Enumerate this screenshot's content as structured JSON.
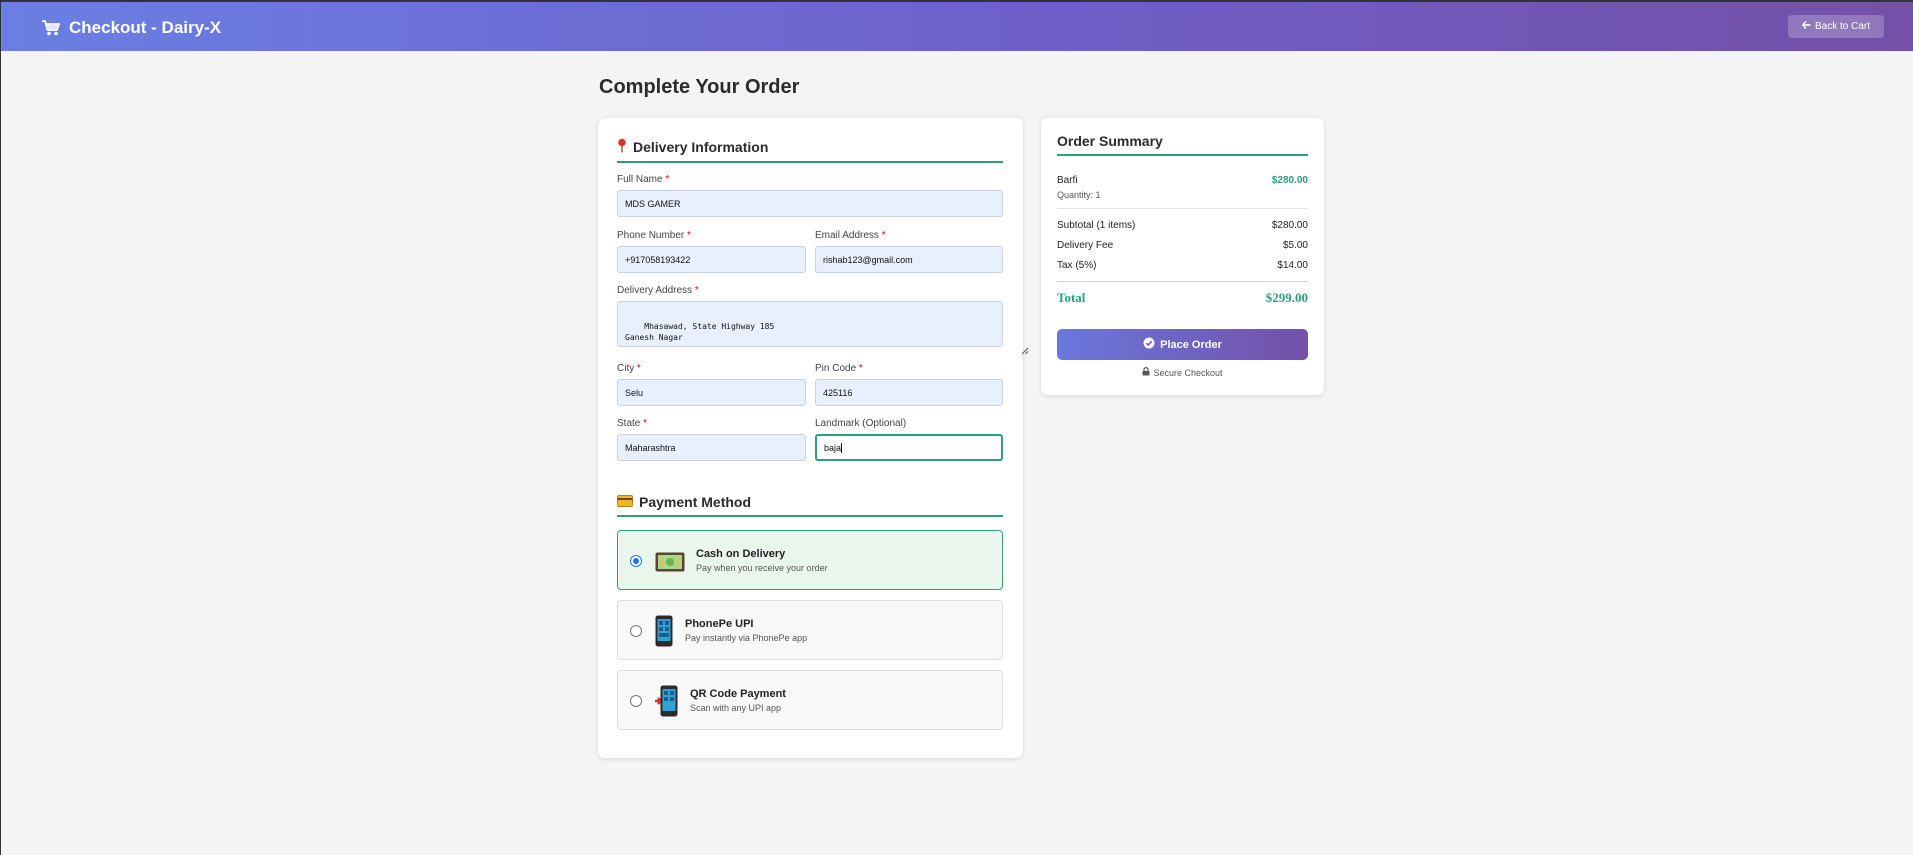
{
  "header": {
    "title": "Checkout - Dairy-X",
    "back_label": "Back to Cart"
  },
  "page_title": "Complete Your Order",
  "delivery": {
    "heading": "Delivery Information",
    "full_name": {
      "label": "Full Name",
      "value": "MDS GAMER"
    },
    "phone": {
      "label": "Phone Number",
      "value": "+917058193422"
    },
    "email": {
      "label": "Email Address",
      "value": "rishab123@gmail.com"
    },
    "address": {
      "label": "Delivery Address",
      "value": "Mhasawad, State Highway 185\nGanesh Nagar"
    },
    "city": {
      "label": "City",
      "value": "Selu"
    },
    "pin": {
      "label": "Pin Code",
      "value": "425116"
    },
    "state": {
      "label": "State",
      "value": "Maharashtra"
    },
    "landmark": {
      "label": "Landmark (Optional)",
      "value": "baja"
    },
    "required_mark": "*"
  },
  "payment": {
    "heading": "Payment Method",
    "options": [
      {
        "title": "Cash on Delivery",
        "subtitle": "Pay when you receive your order",
        "selected": true,
        "icon": "cash-icon"
      },
      {
        "title": "PhonePe UPI",
        "subtitle": "Pay instantly via PhonePe app",
        "selected": false,
        "icon": "mobile-phone-icon"
      },
      {
        "title": "QR Code Payment",
        "subtitle": "Scan with any UPI app",
        "selected": false,
        "icon": "mobile-arrow-icon"
      }
    ]
  },
  "summary": {
    "heading": "Order Summary",
    "item_name": "Barfi",
    "item_qty": "Quantity: 1",
    "item_price": "$280.00",
    "subtotal_label": "Subtotal (1 items)",
    "subtotal_value": "$280.00",
    "delivery_label": "Delivery Fee",
    "delivery_value": "$5.00",
    "tax_label": "Tax (5%)",
    "tax_value": "$14.00",
    "total_label": "Total",
    "total_value": "$299.00",
    "place_order": "Place Order",
    "secure": "Secure Checkout"
  },
  "colors": {
    "accent": "#2aa179",
    "header_start": "#6a7fe3",
    "header_end": "#7450a8",
    "field_bg": "#e8f0fe"
  }
}
